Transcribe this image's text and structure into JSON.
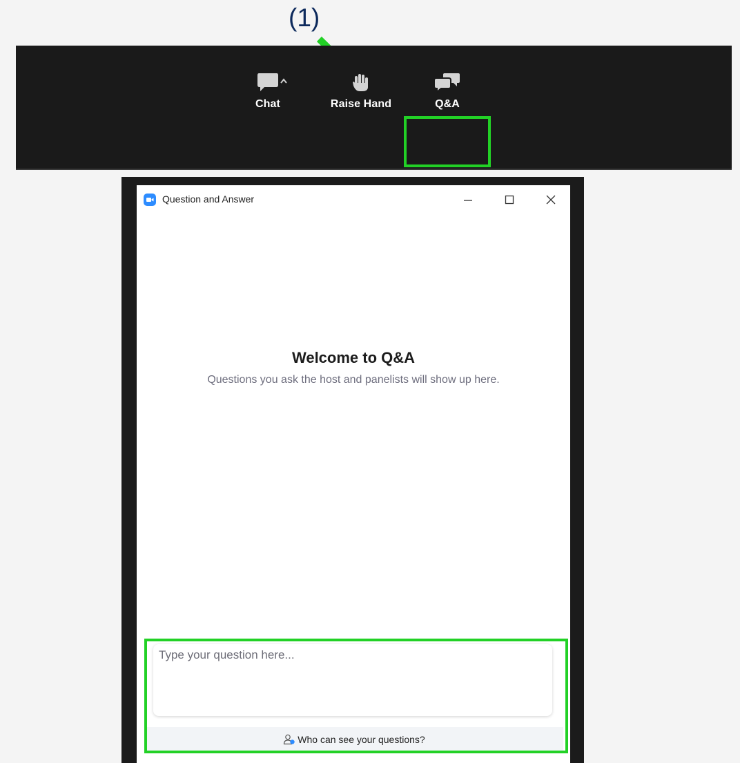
{
  "annotation": {
    "step_label": "(1)",
    "highlight_color": "#22d126"
  },
  "toolbar": {
    "chat": {
      "label": "Chat",
      "icon": "chat-bubble-icon"
    },
    "raise_hand": {
      "label": "Raise Hand",
      "icon": "raise-hand-icon"
    },
    "qa": {
      "label": "Q&A",
      "icon": "qa-bubbles-icon"
    },
    "chat_options_icon": "caret-up-icon"
  },
  "window": {
    "title": "Question and Answer",
    "app_icon": "zoom-app-icon",
    "controls": [
      "minimize-icon",
      "maximize-icon",
      "close-icon"
    ]
  },
  "main": {
    "heading": "Welcome to Q&A",
    "description": "Questions you ask the host and panelists will show up here."
  },
  "composer": {
    "placeholder": "Type your question here...",
    "value": ""
  },
  "footer": {
    "who_can_see_label": "Who can see your questions?",
    "icon": "person-icon"
  },
  "colors": {
    "toolbar_bg": "#1a1a1a",
    "accent": "#2d8cff",
    "page_bg": "#f4f4f4"
  }
}
